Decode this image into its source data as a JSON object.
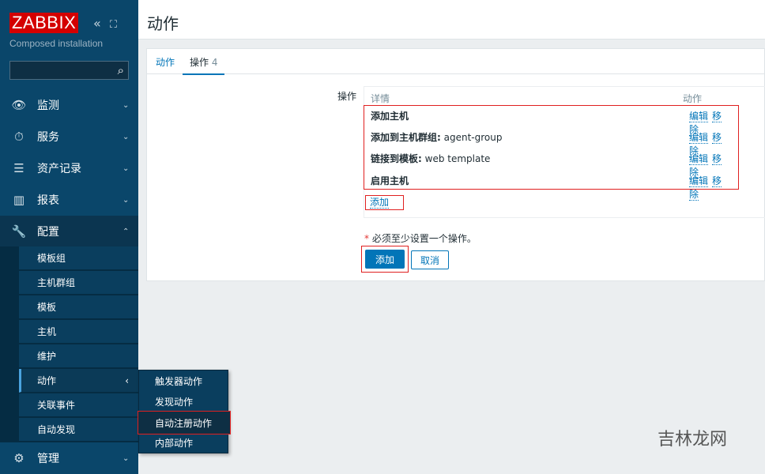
{
  "sidebar": {
    "logo": "ZABBIX",
    "collapse_icon": "«",
    "kiosk_icon": "⛶",
    "subtitle": "Composed installation",
    "search": {
      "value": "",
      "placeholder": ""
    },
    "items": [
      {
        "label": "监测",
        "icon": "eye-icon",
        "glyph": "👁"
      },
      {
        "label": "服务",
        "icon": "stopwatch-icon",
        "glyph": "⏱"
      },
      {
        "label": "资产记录",
        "icon": "list-icon",
        "glyph": "☰"
      },
      {
        "label": "报表",
        "icon": "bar-chart-icon",
        "glyph": "▥"
      },
      {
        "label": "配置",
        "icon": "wrench-icon",
        "glyph": "🔧"
      }
    ],
    "config_sub": [
      "模板组",
      "主机群组",
      "模板",
      "主机",
      "维护",
      "动作",
      "关联事件",
      "自动发现"
    ],
    "bottom": {
      "label": "管理",
      "icon": "gear-icon",
      "glyph": "⚙"
    },
    "flyout": [
      "触发器动作",
      "发现动作",
      "自动注册动作",
      "内部动作"
    ]
  },
  "header": {
    "title": "动作"
  },
  "tabs": [
    {
      "label": "动作",
      "count": ""
    },
    {
      "label": "操作",
      "count": "4"
    }
  ],
  "form": {
    "label": "操作",
    "columns": {
      "details": "详情",
      "action": "动作"
    },
    "operations": [
      {
        "bold": "添加主机",
        "rest": ""
      },
      {
        "bold": "添加到主机群组:",
        "rest": " agent-group"
      },
      {
        "bold": "链接到模板:",
        "rest": " web template"
      },
      {
        "bold": "启用主机",
        "rest": ""
      }
    ],
    "edit": "编辑",
    "remove": "移除",
    "add_link": "添加",
    "required_note": "必须至少设置一个操作。",
    "required_star": "*",
    "add_button": "添加",
    "cancel_button": "取消"
  },
  "watermark": "吉林龙网"
}
